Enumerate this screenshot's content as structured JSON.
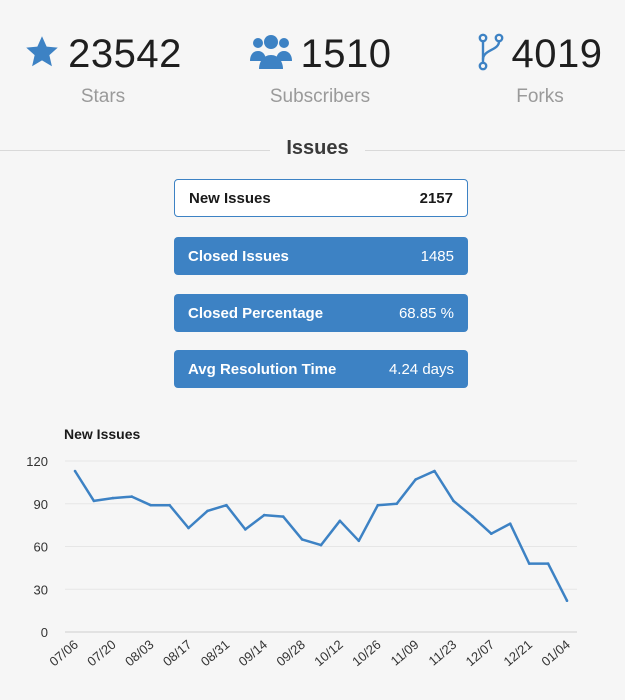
{
  "stats": {
    "stars": {
      "value": "23542",
      "label": "Stars",
      "icon": "star-icon"
    },
    "subscribers": {
      "value": "1510",
      "label": "Subscribers",
      "icon": "users-icon"
    },
    "forks": {
      "value": "4019",
      "label": "Forks",
      "icon": "fork-icon"
    }
  },
  "issues": {
    "title": "Issues",
    "metrics": [
      {
        "label": "New Issues",
        "value": "2157",
        "style": "outline"
      },
      {
        "label": "Closed Issues",
        "value": "1485",
        "style": "filled"
      },
      {
        "label": "Closed Percentage",
        "value": "68.85 %",
        "style": "filled"
      },
      {
        "label": "Avg Resolution Time",
        "value": "4.24 days",
        "style": "filled"
      }
    ]
  },
  "colors": {
    "accent": "#3d82c4",
    "icon": "#3d82c4",
    "label_gray": "#9a9a9a",
    "grid": "#e6e6e6",
    "background": "#f6f6f6"
  },
  "chart_data": {
    "type": "line",
    "title": "New Issues",
    "xlabel": "",
    "ylabel": "",
    "ylim": [
      0,
      120
    ],
    "yticks": [
      0,
      30,
      60,
      90,
      120
    ],
    "grid": true,
    "xtick_labels": [
      "07/06",
      "07/20",
      "08/03",
      "08/17",
      "08/31",
      "09/14",
      "09/28",
      "10/12",
      "10/26",
      "11/09",
      "11/23",
      "12/07",
      "12/21",
      "01/04"
    ],
    "series": [
      {
        "values": [
          113,
          92,
          94,
          95,
          89,
          89,
          73,
          85,
          89,
          72,
          82,
          81,
          65,
          61,
          78,
          64,
          89,
          90,
          107,
          113,
          92,
          81,
          69,
          76,
          48,
          48,
          22
        ]
      }
    ]
  }
}
